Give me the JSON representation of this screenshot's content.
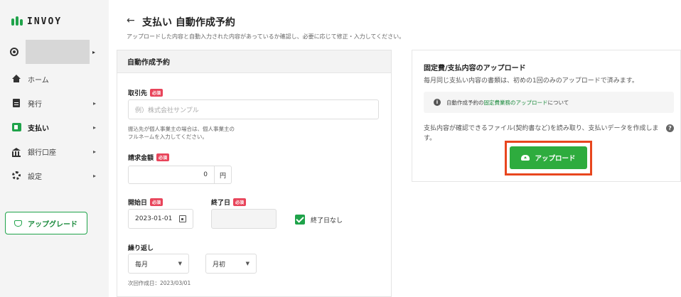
{
  "app": {
    "logo_text": "INVOY"
  },
  "sidebar": {
    "items": [
      {
        "label": "ホーム",
        "icon": "home-icon"
      },
      {
        "label": "発行",
        "icon": "document-icon"
      },
      {
        "label": "支払い",
        "icon": "payment-icon"
      },
      {
        "label": "銀行口座",
        "icon": "bank-icon"
      },
      {
        "label": "設定",
        "icon": "gear-icon"
      }
    ],
    "upgrade_label": "アップグレード"
  },
  "header": {
    "back": "←",
    "title": "支払い 自動作成予約",
    "subtitle": "アップロードした内容と自動入力された内容があっているか確認し、必要に応じて修正・入力してください。"
  },
  "form": {
    "card_title": "自動作成予約",
    "required_badge": "必須",
    "client": {
      "label": "取引先",
      "placeholder": "例）株式会社サンプル",
      "hint": "振込先が個人事業主の場合は、個人事業主の\nフルネームを入力してください。"
    },
    "amount": {
      "label": "請求金額",
      "value": "0",
      "unit": "円"
    },
    "start_date": {
      "label": "開始日",
      "value": "2023-01-01"
    },
    "end_date": {
      "label": "終了日",
      "value": ""
    },
    "no_end_date": {
      "label": "終了日なし",
      "checked": true
    },
    "repeat": {
      "label": "繰り返し",
      "frequency": "毎月",
      "day": "月初",
      "next_date": "次回作成日：2023/03/01"
    }
  },
  "upload": {
    "title": "固定費/支払内容のアップロード",
    "subtitle": "毎月同じ支払い内容の書類は、初めの1回のみのアップロードで済みます。",
    "info_prefix": "自動作成予約の",
    "info_link": "固定費業務のアップロード",
    "info_suffix": "について",
    "description": "支払内容が確認できるファイル(契約書など)を読み取り、支払いデータを作成します。",
    "button_label": "アップロード"
  },
  "colors": {
    "accent": "#2eac3e",
    "required": "#e8445a",
    "highlight": "#e8461e"
  }
}
